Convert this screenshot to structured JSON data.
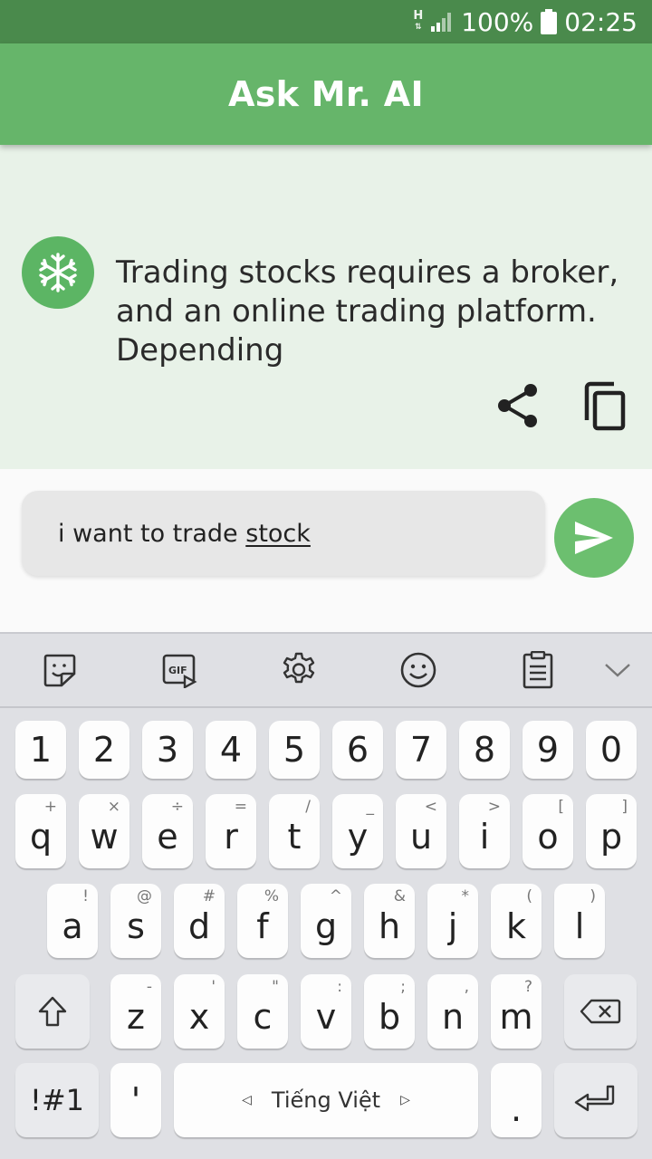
{
  "status_bar": {
    "network": "H",
    "battery": "100%",
    "time": "02:25"
  },
  "app_bar": {
    "title": "Ask Mr. AI"
  },
  "chat": {
    "bot_message": "Trading stocks requires a broker, and an online trading platform. Depending",
    "actions": {
      "share": "share-icon",
      "copy": "copy-icon"
    }
  },
  "input": {
    "text_prefix": "i want to trade ",
    "text_underlined": "stock"
  },
  "keyboard": {
    "toolbar": [
      "sticker-icon",
      "gif-icon",
      "settings-icon",
      "emoji-icon",
      "clipboard-icon",
      "collapse-icon"
    ],
    "number_row": [
      "1",
      "2",
      "3",
      "4",
      "5",
      "6",
      "7",
      "8",
      "9",
      "0"
    ],
    "row1": [
      {
        "key": "q",
        "sec": "+"
      },
      {
        "key": "w",
        "sec": "×"
      },
      {
        "key": "e",
        "sec": "÷"
      },
      {
        "key": "r",
        "sec": "="
      },
      {
        "key": "t",
        "sec": "/"
      },
      {
        "key": "y",
        "sec": "_"
      },
      {
        "key": "u",
        "sec": "<"
      },
      {
        "key": "i",
        "sec": ">"
      },
      {
        "key": "o",
        "sec": "["
      },
      {
        "key": "p",
        "sec": "]"
      }
    ],
    "row2": [
      {
        "key": "a",
        "sec": "!"
      },
      {
        "key": "s",
        "sec": "@"
      },
      {
        "key": "d",
        "sec": "#"
      },
      {
        "key": "f",
        "sec": "%"
      },
      {
        "key": "g",
        "sec": "^"
      },
      {
        "key": "h",
        "sec": "&"
      },
      {
        "key": "j",
        "sec": "*"
      },
      {
        "key": "k",
        "sec": "("
      },
      {
        "key": "l",
        "sec": ")"
      }
    ],
    "row3": [
      {
        "key": "z",
        "sec": "-"
      },
      {
        "key": "x",
        "sec": "'"
      },
      {
        "key": "c",
        "sec": "\""
      },
      {
        "key": "v",
        "sec": ":"
      },
      {
        "key": "b",
        "sec": ";"
      },
      {
        "key": "n",
        "sec": ","
      },
      {
        "key": "m",
        "sec": "?"
      }
    ],
    "symbols_label": "!#1",
    "apostrophe_label": "'",
    "space_label": "Tiếng Việt",
    "period_label": "."
  },
  "colors": {
    "status_bar": "#4a8a4c",
    "app_bar": "#66b56a",
    "chat_bg": "#e8f2e8",
    "accent": "#5cb564",
    "keyboard_bg": "#dfe0e4"
  }
}
